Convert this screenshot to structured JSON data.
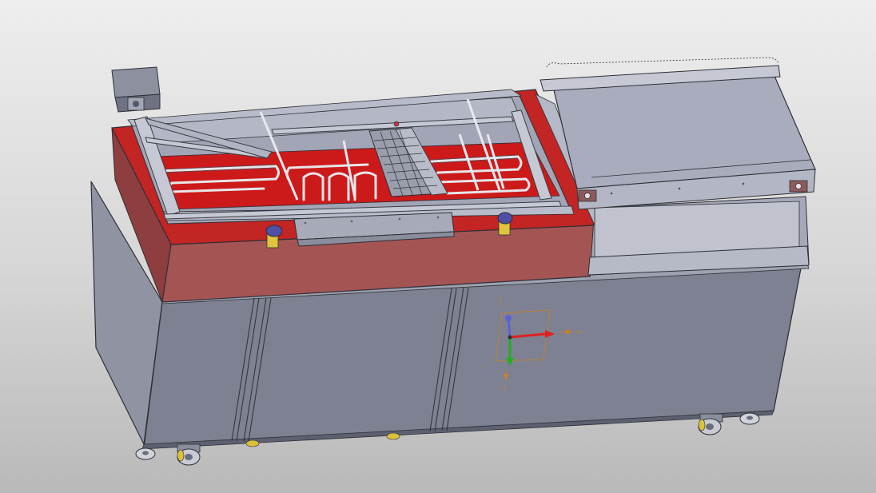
{
  "viewport": {
    "background_top": "#eeeeee",
    "background_bottom": "#b9b9b9"
  },
  "model": {
    "body_color": "#7d8191",
    "body_edge_color": "#2e3036",
    "tank_color": "#a55454",
    "tank_inner_color": "#cc1a1a",
    "top_panel_color": "#a9acbd",
    "knob_color": "#4f4fa8",
    "bracket_color": "#e0c53c"
  },
  "triad": {
    "x_axis_color": "#e02020",
    "y_axis_color": "#20b020",
    "z_axis_color": "#6060d0",
    "secondary_color": "#d08020",
    "axis_label": "^"
  }
}
